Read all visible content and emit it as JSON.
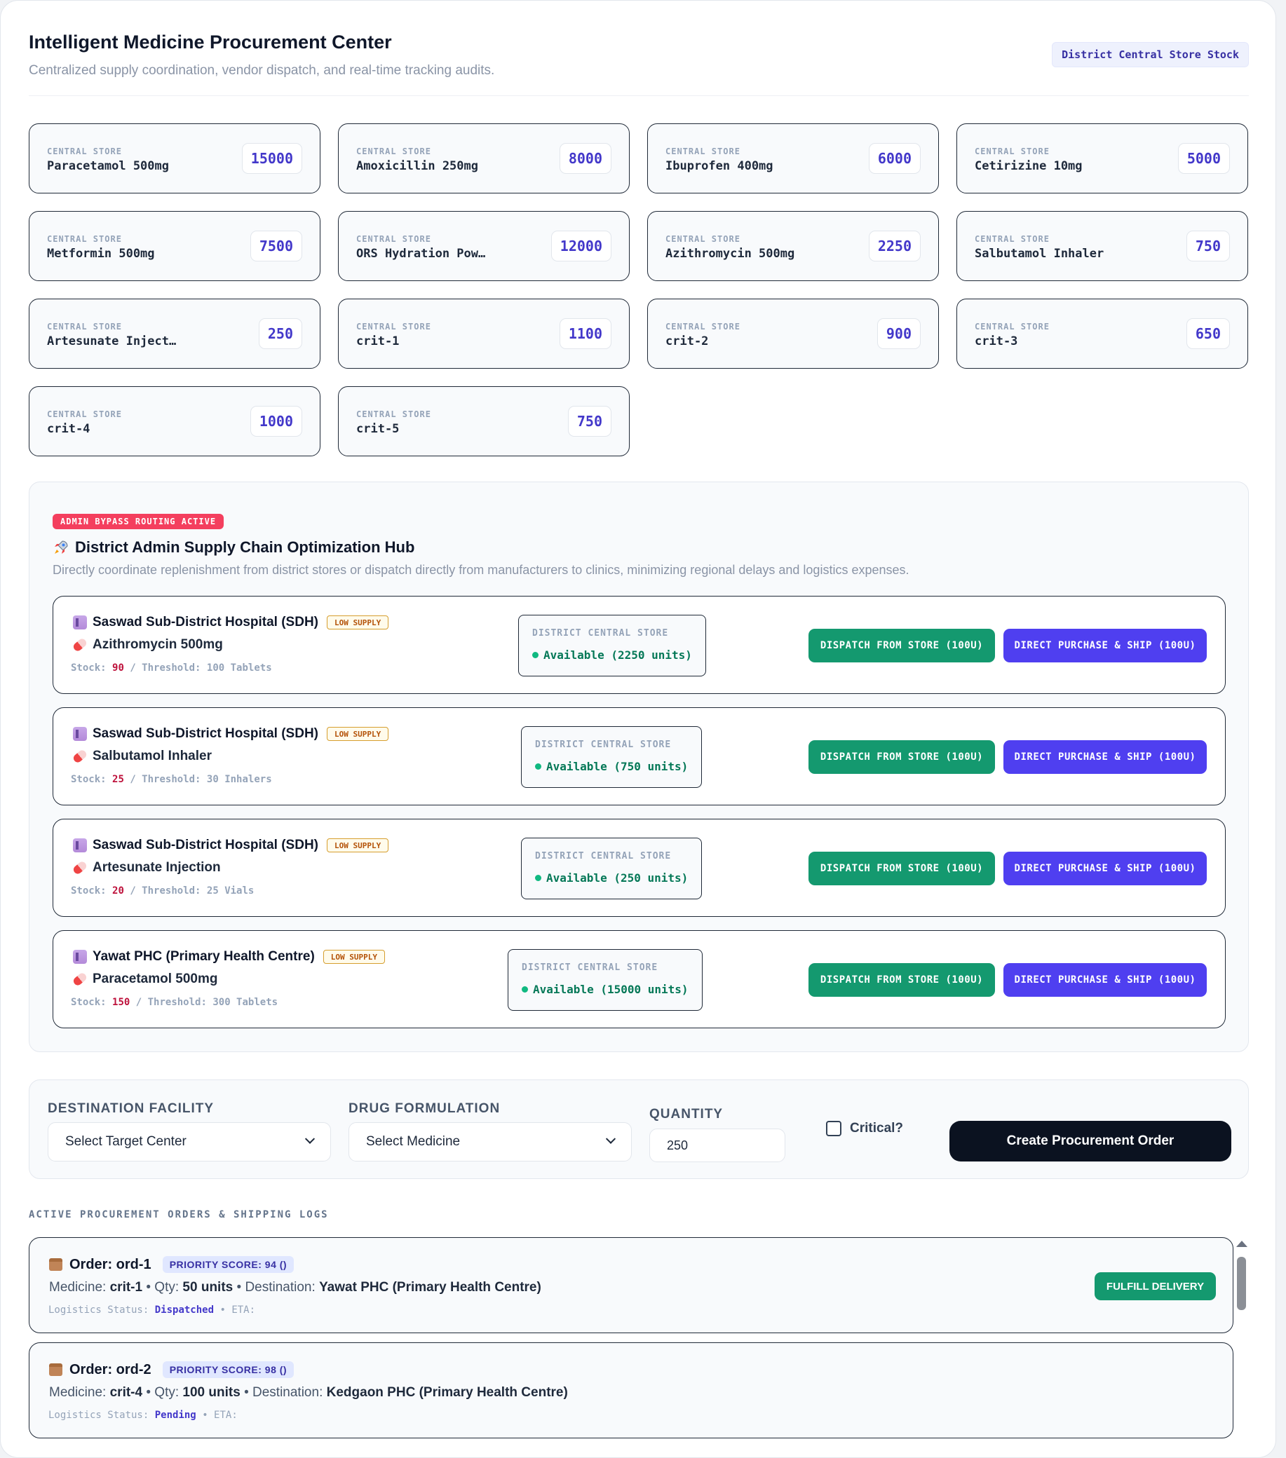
{
  "header": {
    "title": "Intelligent Medicine Procurement Center",
    "subtitle": "Centralized supply coordination, vendor dispatch, and real-time tracking audits.",
    "badge": "District Central Store Stock"
  },
  "stock": {
    "label": "CENTRAL STORE",
    "items": [
      {
        "name": "Paracetamol 500mg",
        "qty": "15000"
      },
      {
        "name": "Amoxicillin 250mg",
        "qty": "8000"
      },
      {
        "name": "Ibuprofen 400mg",
        "qty": "6000"
      },
      {
        "name": "Cetirizine 10mg",
        "qty": "5000"
      },
      {
        "name": "Metformin 500mg",
        "qty": "7500"
      },
      {
        "name": "ORS Hydration Pow…",
        "qty": "12000"
      },
      {
        "name": "Azithromycin 500mg",
        "qty": "2250"
      },
      {
        "name": "Salbutamol Inhaler",
        "qty": "750"
      },
      {
        "name": "Artesunate Inject…",
        "qty": "250"
      },
      {
        "name": "crit-1",
        "qty": "1100"
      },
      {
        "name": "crit-2",
        "qty": "900"
      },
      {
        "name": "crit-3",
        "qty": "650"
      },
      {
        "name": "crit-4",
        "qty": "1000"
      },
      {
        "name": "crit-5",
        "qty": "750"
      }
    ]
  },
  "hub": {
    "flag": "ADMIN BYPASS ROUTING ACTIVE",
    "icon": "rocket-icon",
    "title": "District Admin Supply Chain Optimization Hub",
    "subtitle": "Directly coordinate replenishment from district stores or dispatch directly from manufacturers to clinics, minimizing regional delays and logistics expenses.",
    "low_badge": "LOW SUPPLY",
    "store_label": "DISTRICT CENTRAL STORE",
    "stock_prefix": "Stock:",
    "threshold_sep": "/ Threshold:",
    "dispatch_label": "DISPATCH FROM STORE (100U)",
    "purchase_label": "DIRECT PURCHASE & SHIP (100U)",
    "recommendations": [
      {
        "facility": "Saswad Sub-District Hospital (SDH)",
        "medicine": "Azithromycin 500mg",
        "stock": "90",
        "threshold": "100 Tablets",
        "available": "Available (2250 units)"
      },
      {
        "facility": "Saswad Sub-District Hospital (SDH)",
        "medicine": "Salbutamol Inhaler",
        "stock": "25",
        "threshold": "30 Inhalers",
        "available": "Available (750 units)"
      },
      {
        "facility": "Saswad Sub-District Hospital (SDH)",
        "medicine": "Artesunate Injection",
        "stock": "20",
        "threshold": "25 Vials",
        "available": "Available (250 units)"
      },
      {
        "facility": "Yawat PHC (Primary Health Centre)",
        "medicine": "Paracetamol 500mg",
        "stock": "150",
        "threshold": "300 Tablets",
        "available": "Available (15000 units)"
      }
    ]
  },
  "form": {
    "destination_label": "DESTINATION FACILITY",
    "destination_value": "Select Target Center",
    "drug_label": "DRUG FORMULATION",
    "drug_value": "Select Medicine",
    "quantity_label": "QUANTITY",
    "quantity_value": "250",
    "critical_label": "Critical?",
    "critical_checked": false,
    "submit_label": "Create Procurement Order"
  },
  "orders": {
    "section_label": "ACTIVE PROCUREMENT ORDERS & SHIPPING LOGS",
    "items": [
      {
        "order": "Order: ord-1",
        "priority": "PRIORITY SCORE: 94 ()",
        "medicine": "crit-1",
        "qty": "50 units",
        "destination": "Yawat PHC (Primary Health Centre)",
        "status": "Dispatched",
        "eta": "",
        "action": "FULFILL DELIVERY"
      },
      {
        "order": "Order: ord-2",
        "priority": "PRIORITY SCORE: 98 ()",
        "medicine": "crit-4",
        "qty": "100 units",
        "destination": "Kedgaon PHC (Primary Health Centre)",
        "status": "Pending",
        "eta": "",
        "action": ""
      }
    ],
    "medicine_prefix": "Medicine:",
    "qty_prefix": "• Qty:",
    "dest_prefix": "• Destination:",
    "status_prefix": "Logistics Status:",
    "eta_prefix": "• ETA:"
  },
  "colors": {
    "accent": "#4338ca",
    "dispatch_green": "#14996f",
    "purchase_purple": "#4f3ff0",
    "alert_red": "#f43f5e",
    "submit_dark": "#0b1220"
  }
}
